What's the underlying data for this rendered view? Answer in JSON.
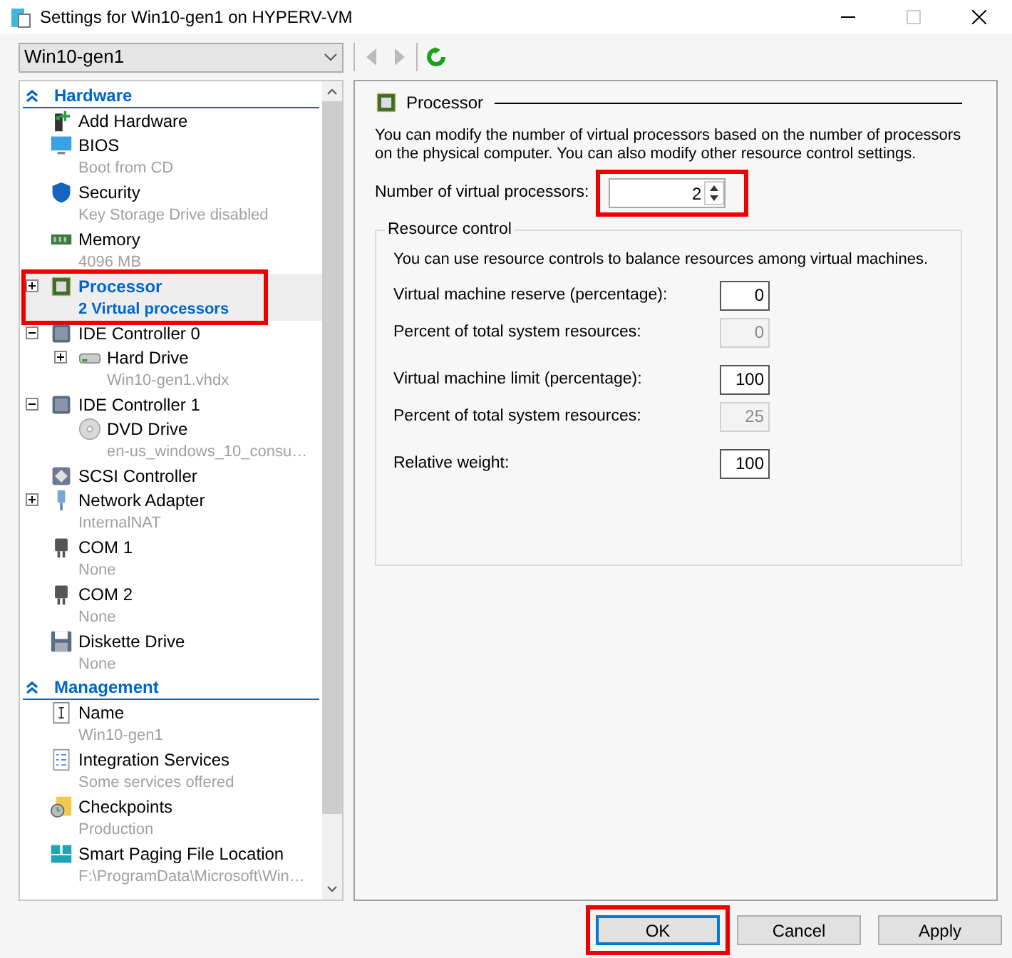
{
  "window": {
    "title": "Settings for Win10-gen1 on HYPERV-VM"
  },
  "vm_select": {
    "value": "Win10-gen1"
  },
  "tree": [
    {
      "title": "Hardware",
      "items": [
        {
          "name": "Add Hardware",
          "kind": "add-hardware",
          "selected": false
        },
        {
          "name": "BIOS",
          "detail": "Boot from CD",
          "kind": "monitor",
          "selected": false
        },
        {
          "name": "Security",
          "detail": "Key Storage Drive disabled",
          "kind": "shield",
          "selected": false
        },
        {
          "name": "Memory",
          "detail": "4096 MB",
          "kind": "memory",
          "selected": false
        },
        {
          "name": "Processor",
          "detail": "2 Virtual processors",
          "kind": "chip",
          "expanded": false,
          "selected": true,
          "highlighted": true
        },
        {
          "name": "IDE Controller 0",
          "kind": "controller",
          "expanded": true,
          "selected": false,
          "children": [
            {
              "name": "Hard Drive",
              "detail": "Win10-gen1.vhdx",
              "kind": "disk",
              "expanded": false,
              "selected": false
            }
          ]
        },
        {
          "name": "IDE Controller 1",
          "kind": "controller",
          "expanded": true,
          "selected": false,
          "children": [
            {
              "name": "DVD Drive",
              "detail": "en-us_windows_10_consu…",
              "kind": "dvd",
              "selected": false
            }
          ]
        },
        {
          "name": "SCSI Controller",
          "kind": "scsi",
          "selected": false
        },
        {
          "name": "Network Adapter",
          "detail": "InternalNAT",
          "kind": "network",
          "expanded": false,
          "selected": false
        },
        {
          "name": "COM 1",
          "detail": "None",
          "kind": "port",
          "selected": false
        },
        {
          "name": "COM 2",
          "detail": "None",
          "kind": "port",
          "selected": false
        },
        {
          "name": "Diskette Drive",
          "detail": "None",
          "kind": "floppy",
          "selected": false
        }
      ]
    },
    {
      "title": "Management",
      "items": [
        {
          "name": "Name",
          "detail": "Win10-gen1",
          "kind": "name",
          "selected": false
        },
        {
          "name": "Integration Services",
          "detail": "Some services offered",
          "kind": "checklist",
          "selected": false
        },
        {
          "name": "Checkpoints",
          "detail": "Production",
          "kind": "checkpoint",
          "selected": false
        },
        {
          "name": "Smart Paging File Location",
          "detail": "F:\\ProgramData\\Microsoft\\Win…",
          "kind": "paging",
          "selected": false
        }
      ]
    }
  ],
  "panel": {
    "title": "Processor",
    "description": "You can modify the number of virtual processors based on the number of processors on the physical computer. You can also modify other resource control settings.",
    "processors": {
      "label": "Number of virtual processors:",
      "value": "2",
      "highlighted": true
    },
    "resource_control": {
      "title": "Resource control",
      "description": "You can use resource controls to balance resources among virtual machines.",
      "rows": [
        {
          "label": "Virtual machine reserve (percentage):",
          "value": "0",
          "disabled": false
        },
        {
          "label": "Percent of total system resources:",
          "value": "0",
          "disabled": true
        },
        {
          "label": "Virtual machine limit (percentage):",
          "value": "100",
          "disabled": false
        },
        {
          "label": "Percent of total system resources:",
          "value": "25",
          "disabled": true
        },
        {
          "label": "Relative weight:",
          "value": "100",
          "disabled": false
        }
      ]
    }
  },
  "buttons": [
    {
      "label": "OK",
      "default": true,
      "highlighted": true
    },
    {
      "label": "Cancel",
      "default": false,
      "highlighted": false
    },
    {
      "label": "Apply",
      "default": false,
      "highlighted": false
    }
  ]
}
